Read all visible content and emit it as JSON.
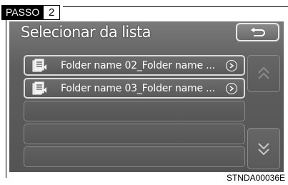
{
  "step": {
    "label": "PASSO",
    "number": "2"
  },
  "screen": {
    "title": "Selecionar da lista",
    "back_icon": "return-arrow-icon",
    "items": [
      {
        "label": "Folder name 02_Folder name ...",
        "icon": "document-list-icon"
      },
      {
        "label": "Folder name 03_Folder name ...",
        "icon": "document-list-icon"
      }
    ],
    "scroll_up_icon": "double-chevron-up-icon",
    "scroll_down_icon": "double-chevron-down-icon"
  },
  "caption": "STNDA00036E"
}
